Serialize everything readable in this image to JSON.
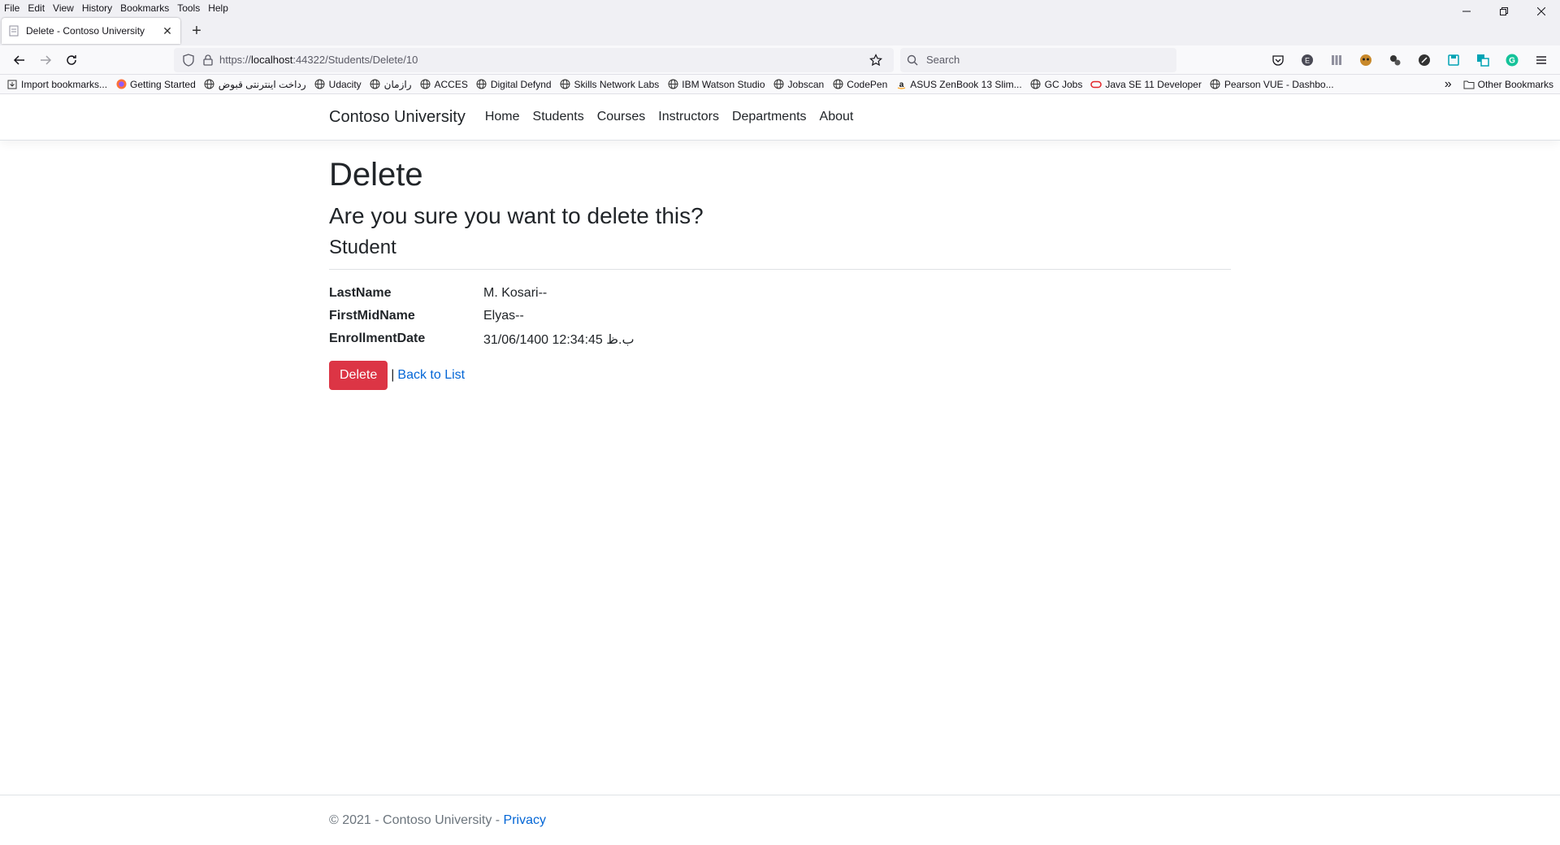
{
  "menubar": {
    "items": [
      "File",
      "Edit",
      "View",
      "History",
      "Bookmarks",
      "Tools",
      "Help"
    ]
  },
  "tab": {
    "title": "Delete - Contoso University",
    "close": "✕",
    "new_tab": "+"
  },
  "urlbar": {
    "scheme": "https://",
    "host": "localhost",
    "path": ":44322/Students/Delete/10"
  },
  "searchbar": {
    "placeholder": "Search"
  },
  "bookmarks": {
    "items": [
      "Import bookmarks...",
      "Getting Started",
      "رداخت اینترنتی قبوض",
      "Udacity",
      "رازمان",
      "ACCES",
      "Digital Defynd",
      "Skills Network Labs",
      "IBM Watson Studio",
      "Jobscan",
      "CodePen",
      "ASUS ZenBook 13 Slim...",
      "GC Jobs",
      "Java SE 11 Developer",
      "Pearson VUE - Dashbo..."
    ],
    "other": "Other Bookmarks",
    "overflow": "»"
  },
  "site": {
    "brand": "Contoso University",
    "nav": [
      "Home",
      "Students",
      "Courses",
      "Instructors",
      "Departments",
      "About"
    ]
  },
  "page": {
    "title": "Delete",
    "confirm": "Are you sure you want to delete this?",
    "entity": "Student",
    "fields": [
      {
        "label": "LastName",
        "value": "M. Kosari--"
      },
      {
        "label": "FirstMidName",
        "value": "Elyas--"
      },
      {
        "label": "EnrollmentDate",
        "value": "31/06/1400 12:34:45 ب.ظ"
      }
    ],
    "delete_button": "Delete",
    "separator": "|",
    "back_link": "Back to List"
  },
  "footer": {
    "text": "© 2021 - Contoso University - ",
    "privacy": "Privacy"
  },
  "colors": {
    "danger": "#dc3545",
    "link": "#0366d6"
  }
}
